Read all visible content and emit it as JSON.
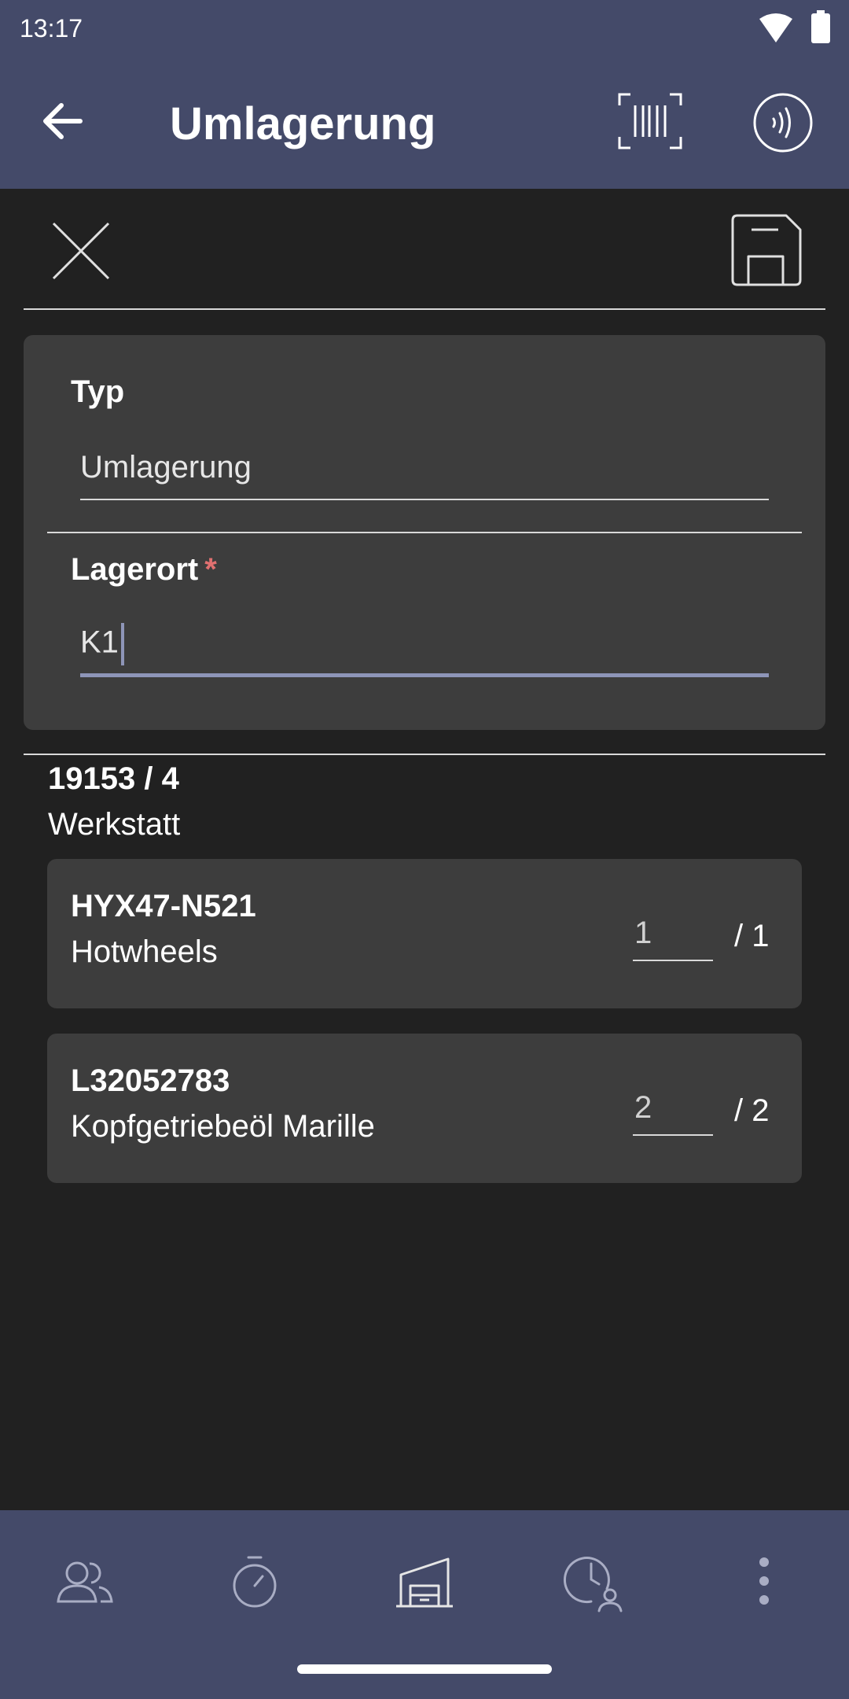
{
  "status_bar": {
    "time": "13:17",
    "wifi_badge": "4",
    "icons": [
      "wifi-icon",
      "battery-icon"
    ]
  },
  "app_bar": {
    "title": "Umlagerung",
    "back_icon": "arrow-left-icon",
    "barcode_icon": "barcode-scan-icon",
    "nfc_icon": "nfc-icon"
  },
  "toolbar": {
    "close_icon": "close-icon",
    "save_icon": "floppy-disk-icon"
  },
  "form": {
    "type_label": "Typ",
    "type_value": "Umlagerung",
    "location_label": "Lagerort",
    "location_required": "*",
    "location_value": "K1"
  },
  "order": {
    "number": "19153 / 4",
    "location": "Werkstatt",
    "items": [
      {
        "code": "HYX47-N521",
        "name": "Hotwheels",
        "quantity": "1",
        "total": "/ 1"
      },
      {
        "code": "L32052783",
        "name": "Kopfgetriebeöl Marille",
        "quantity": "2",
        "total": "/ 2"
      }
    ]
  },
  "bottom_nav": {
    "items": [
      "people-icon",
      "stopwatch-icon",
      "warehouse-icon",
      "clock-user-icon",
      "more-vertical-icon"
    ]
  },
  "colors": {
    "bar_background": "#444a69",
    "page_background": "#212121",
    "card_background": "#3d3d3d",
    "accent": "#8e95b8",
    "required": "#e07070"
  }
}
